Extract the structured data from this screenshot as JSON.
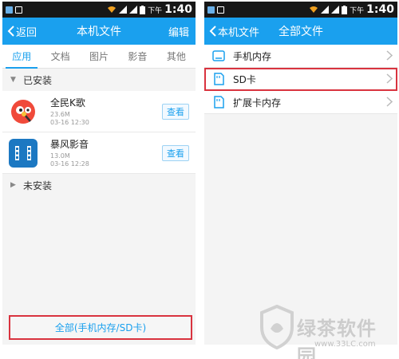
{
  "status": {
    "ampm": "下午",
    "time": "1:40"
  },
  "left": {
    "back_label": "返回",
    "title": "本机文件",
    "action": "编辑",
    "tabs": [
      {
        "label": "应用",
        "active": true
      },
      {
        "label": "文档",
        "active": false
      },
      {
        "label": "图片",
        "active": false
      },
      {
        "label": "影音",
        "active": false
      },
      {
        "label": "其他",
        "active": false
      }
    ],
    "installed_label": "已安装",
    "apps": [
      {
        "name": "全民K歌",
        "size": "23.6M",
        "date": "03-16 12:30",
        "button": "查看",
        "icon": "karaoke-icon"
      },
      {
        "name": "暴风影音",
        "size": "13.0M",
        "date": "03-16 12:28",
        "button": "查看",
        "icon": "film-icon"
      }
    ],
    "not_installed_label": "未安装",
    "bottom_button": "全部(手机内存/SD卡)"
  },
  "right": {
    "back_label": "本机文件",
    "title": "全部文件",
    "items": [
      {
        "label": "手机内存",
        "icon": "phone-storage-icon"
      },
      {
        "label": "SD卡",
        "icon": "sdcard-icon",
        "highlighted": true
      },
      {
        "label": "扩展卡内存",
        "icon": "sdcard-icon"
      }
    ]
  },
  "watermark": {
    "text": "绿茶软件园",
    "url": "www.33LC.com"
  },
  "colors": {
    "accent": "#1aa0ee",
    "highlight": "#d9333f"
  }
}
